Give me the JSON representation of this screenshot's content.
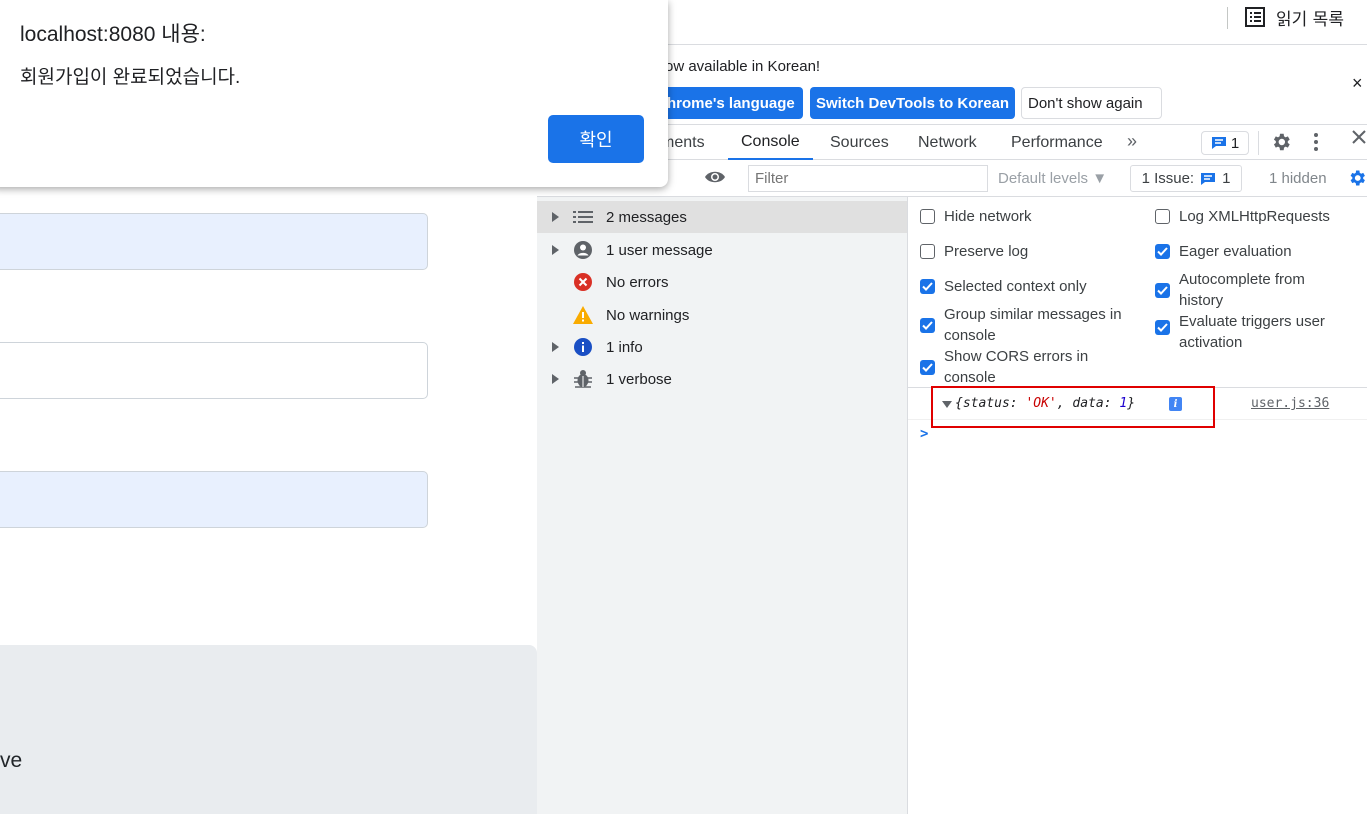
{
  "browser": {
    "reading_list_label": "읽기 목록"
  },
  "alert": {
    "title": "localhost:8080 내용:",
    "message": "회원가입이 완료되었습니다.",
    "ok_label": "확인"
  },
  "page": {
    "footer_text": "ve"
  },
  "devtools": {
    "infobar": {
      "text": "ow available in Korean!",
      "match_language_label": "hrome's language",
      "switch_label": "Switch DevTools to Korean",
      "dont_show_label": "Don't show again",
      "close_symbol": "×"
    },
    "tabs": [
      {
        "label": "ments",
        "active": false
      },
      {
        "label": "Console",
        "active": true
      },
      {
        "label": "Sources",
        "active": false
      },
      {
        "label": "Network",
        "active": false
      },
      {
        "label": "Performance",
        "active": false
      }
    ],
    "more_tabs_symbol": "»",
    "issues_count": "1",
    "toolbar": {
      "filter_placeholder": "Filter",
      "levels_label": "Default levels ▼",
      "issue_label": "1 Issue:",
      "issue_count": "1",
      "hidden_label": "1 hidden"
    },
    "sidebar": [
      {
        "label": "2 messages",
        "icon": "list-icon",
        "expandable": true,
        "selected": true
      },
      {
        "label": "1 user message",
        "icon": "user-icon",
        "expandable": true,
        "selected": false
      },
      {
        "label": "No errors",
        "icon": "error-icon",
        "expandable": false,
        "selected": false
      },
      {
        "label": "No warnings",
        "icon": "warning-icon",
        "expandable": false,
        "selected": false
      },
      {
        "label": "1 info",
        "icon": "info-icon",
        "expandable": true,
        "selected": false
      },
      {
        "label": "1 verbose",
        "icon": "bug-icon",
        "expandable": true,
        "selected": false
      }
    ],
    "settings": [
      {
        "label": "Hide network",
        "checked": false
      },
      {
        "label": "Log XMLHttpRequests",
        "checked": false
      },
      {
        "label": "Preserve log",
        "checked": false
      },
      {
        "label": "Eager evaluation",
        "checked": true
      },
      {
        "label": "Selected context only",
        "checked": true
      },
      {
        "label": "Autocomplete from history",
        "checked": true
      },
      {
        "label": "Group similar messages in console",
        "checked": true
      },
      {
        "label": "Evaluate triggers user activation",
        "checked": true
      },
      {
        "label": "Show CORS errors in console",
        "checked": true
      }
    ],
    "console_log": {
      "open_brace": "{",
      "key1": "status",
      "value1": "'OK'",
      "key2": "data",
      "value2": "1",
      "close_brace": "}",
      "info_badge": "i",
      "source": "user.js:36"
    },
    "prompt_symbol": ">"
  },
  "colors": {
    "accent": "#1a73e8",
    "highlight_border": "#e00000",
    "autofill": "#e8f0fe"
  }
}
